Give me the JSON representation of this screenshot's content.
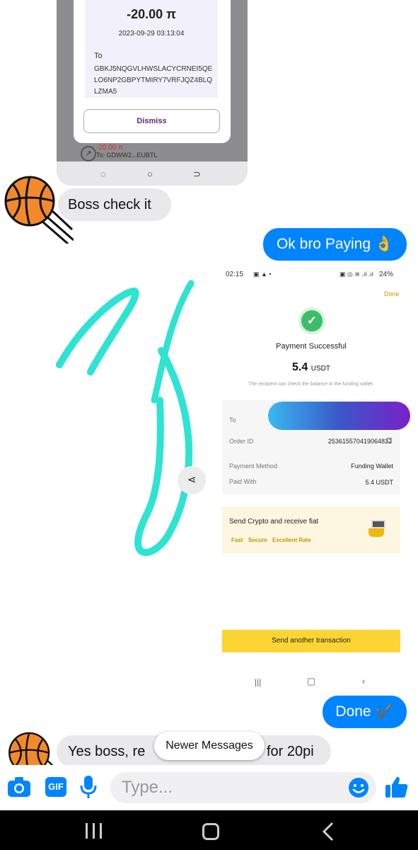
{
  "top_screenshot": {
    "amount": "-20.00 π",
    "date": "2023-09-29 03:13:04",
    "to_label": "To",
    "to_address": "GBKJ5NQGVLHWSLACYCRNEI5QELO6NP2GBPYTMIRY7VRFJQZ4BLQLZMA5",
    "dismiss_label": "Dismiss",
    "peek_amount": "-20.00 π",
    "peek_to": "To: GDWW2...EUBTL"
  },
  "messages": {
    "incoming_1": "Boss check it",
    "outgoing_1": "Ok bro Paying 👌",
    "outgoing_2": "Done ✔️",
    "incoming_2_start": "Yes boss,  re",
    "incoming_2_end": "for 20pi"
  },
  "payment_screenshot": {
    "time": "02:15",
    "battery": "24%",
    "done": "Done",
    "title": "Payment Successful",
    "amount": "5.4",
    "currency": "USDT",
    "note": "The recipient can check the balance in the funding wallet.",
    "to_label": "To",
    "order_id_label": "Order ID",
    "order_id": "253615570419064832",
    "payment_method_label": "Payment Method",
    "payment_method": "Funding Wallet",
    "paid_with_label": "Paid With",
    "paid_with": "5.4 USDT",
    "promo_title": "Send Crypto and receive fiat",
    "promo_tags": [
      "Fast",
      "Secure",
      "Excellent Rate"
    ],
    "send_another": "Send another transaction"
  },
  "newer_messages": "Newer Messages",
  "composer": {
    "placeholder": "Type..."
  },
  "colors": {
    "messenger_blue": "#0084ff",
    "binance_yellow": "#fcd535",
    "doodle": "#2fe3d2"
  }
}
